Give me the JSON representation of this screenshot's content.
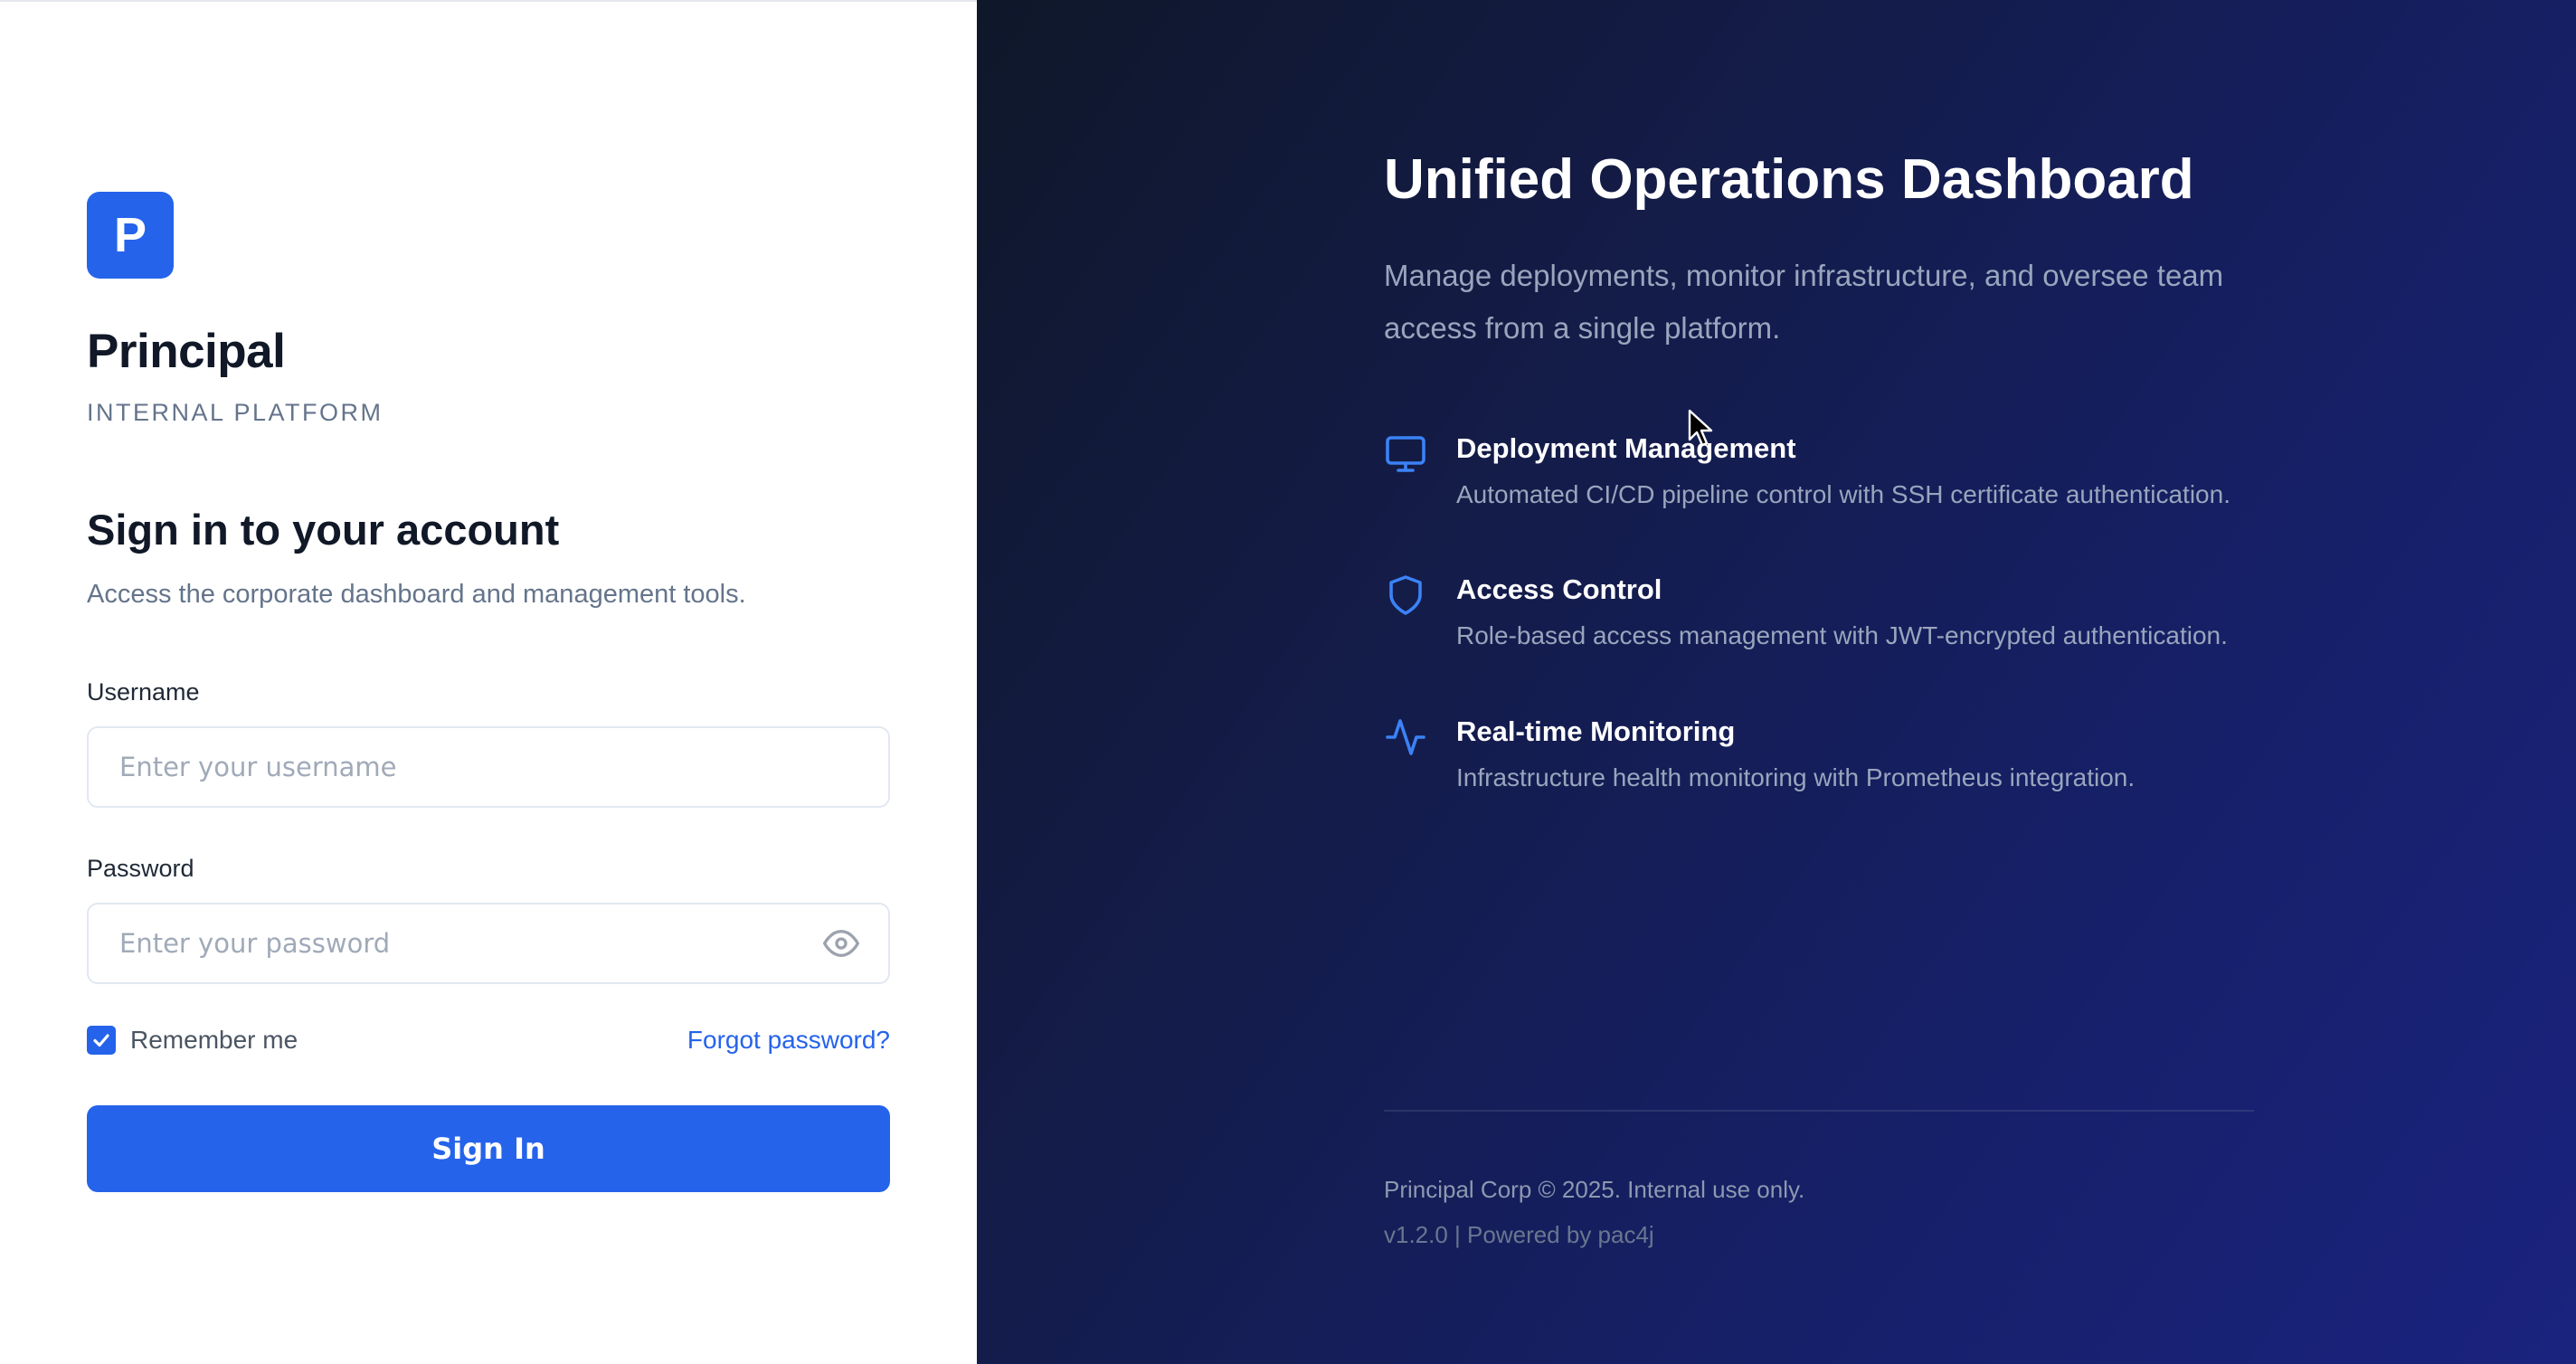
{
  "colors": {
    "accent": "#2563eb",
    "left_bg": "#ffffff",
    "right_bg_start": "#0f172a",
    "right_bg_end": "#1a237e",
    "muted_text": "#64748b"
  },
  "brand": {
    "logo_letter": "P",
    "name": "Principal",
    "tagline": "INTERNAL PLATFORM"
  },
  "login": {
    "heading": "Sign in to your account",
    "subheading": "Access the corporate dashboard and management tools.",
    "username_label": "Username",
    "username_placeholder": "Enter your username",
    "username_value": "",
    "password_label": "Password",
    "password_placeholder": "Enter your password",
    "password_value": "",
    "password_toggle_icon": "eye-icon",
    "remember_label": "Remember me",
    "remember_checked": true,
    "forgot_label": "Forgot password?",
    "signin_label": "Sign In"
  },
  "hero": {
    "title": "Unified Operations Dashboard",
    "description": "Manage deployments, monitor infrastructure, and oversee team access from a single platform.",
    "features": [
      {
        "icon": "monitor-icon",
        "title": "Deployment Management",
        "description": "Automated CI/CD pipeline control with SSH certificate authentication."
      },
      {
        "icon": "shield-icon",
        "title": "Access Control",
        "description": "Role-based access management with JWT-encrypted authentication."
      },
      {
        "icon": "activity-icon",
        "title": "Real-time Monitoring",
        "description": "Infrastructure health monitoring with Prometheus integration."
      }
    ]
  },
  "footer": {
    "copyright": "Principal Corp © 2025. Internal use only.",
    "version": "v1.2.0 | Powered by pac4j"
  }
}
